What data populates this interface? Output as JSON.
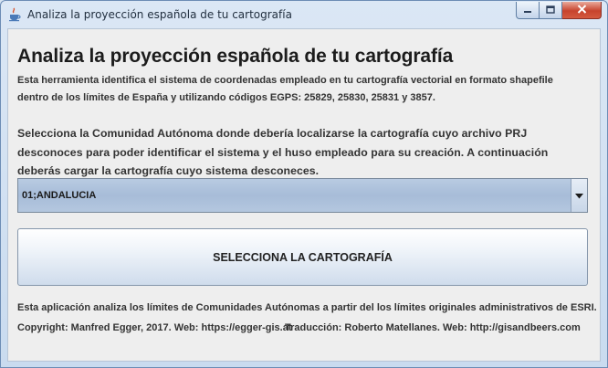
{
  "window": {
    "title": "Analiza la proyección española de tu cartografía"
  },
  "main": {
    "heading": "Analiza la proyección española de tu cartografía",
    "description_line1": "Esta herramienta identifica el sistema de coordenadas empleado en tu cartografía vectorial en formato shapefile",
    "description_line2": "dentro de los límites de España y utilizando códigos EGPS: 25829, 25830, 25831 y 3857.",
    "instructions": "Selecciona la Comunidad Autónoma donde debería localizarse la cartografía cuyo archivo PRJ desconoces para poder identificar el sistema y el huso empleado para su creación. A continuación deberás cargar la cartografía cuyo sistema desconeces.",
    "region_select": {
      "value": "01;ANDALUCIA"
    },
    "select_button_label": "SELECCIONA LA CARTOGRAFÍA"
  },
  "footer": {
    "note": "Esta aplicación analiza los límites de Comunidades Autónomas a partir del los límites originales administrativos de ESRI.",
    "copyright": "Copyright: Manfred Egger, 2017. Web: https://egger-gis.at",
    "translation": "Traducción: Roberto Matellanes. Web: http://gisandbeers.com"
  },
  "icons": {
    "app": "java-cup-icon",
    "minimize": "minimize-icon",
    "maximize": "maximize-icon",
    "close": "close-icon",
    "dropdown": "chevron-down-icon"
  }
}
